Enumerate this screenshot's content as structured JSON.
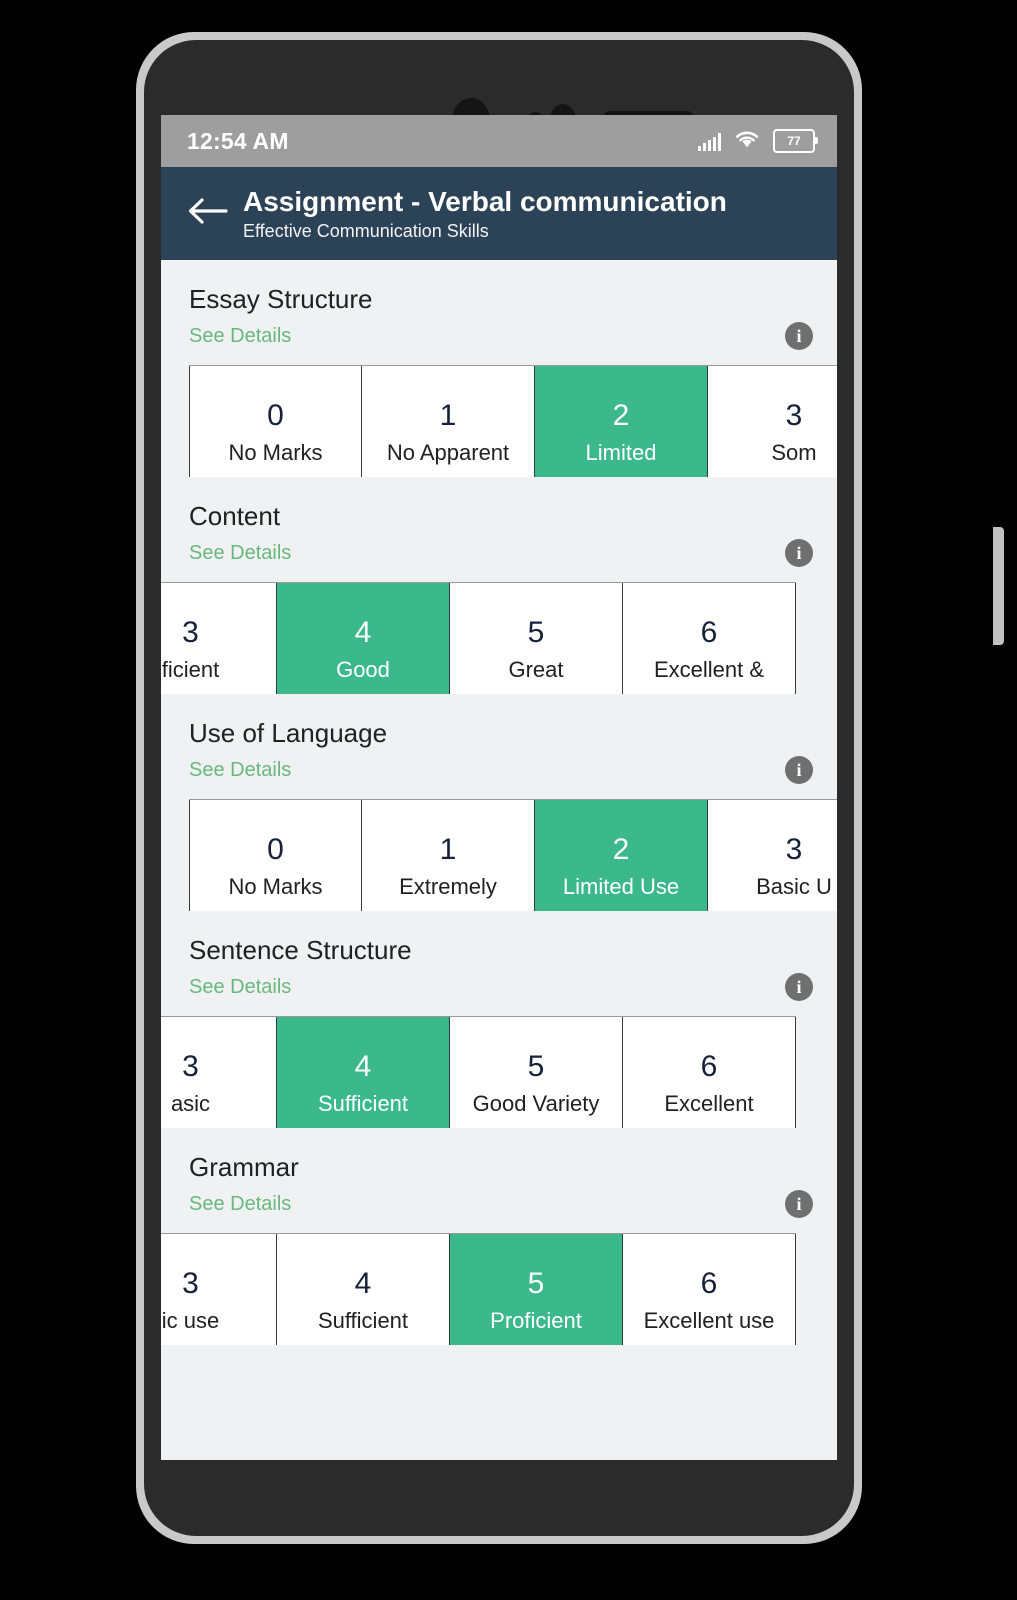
{
  "status_bar": {
    "time": "12:54 AM",
    "signal_icon": "cellular-signal-icon",
    "wifi_icon": "wifi-icon",
    "battery_icon": "battery-icon",
    "battery_level": "77"
  },
  "app_bar": {
    "back_icon": "back-arrow-icon",
    "title": "Assignment - Verbal communication",
    "subtitle": "Effective Communication Skills"
  },
  "common": {
    "see_details_label": "See Details",
    "info_icon": "info-icon",
    "info_glyph": "i",
    "accent_green": "#3bb98a",
    "link_green": "#68b97e",
    "appbar_navy": "#2b4257",
    "page_background": "#eff1f3"
  },
  "criteria": [
    {
      "title": "Essay Structure",
      "scrolled": false,
      "cells": [
        {
          "mark": "0",
          "desc": "No Marks",
          "selected": false
        },
        {
          "mark": "1",
          "desc": "No Apparent",
          "selected": false
        },
        {
          "mark": "2",
          "desc": "Limited",
          "selected": true
        },
        {
          "mark": "3",
          "desc": "Som",
          "selected": false
        }
      ]
    },
    {
      "title": "Content",
      "scrolled": true,
      "cells": [
        {
          "mark": "3",
          "desc": "ficient",
          "selected": false
        },
        {
          "mark": "4",
          "desc": "Good",
          "selected": true
        },
        {
          "mark": "5",
          "desc": "Great",
          "selected": false
        },
        {
          "mark": "6",
          "desc": "Excellent &",
          "selected": false
        }
      ]
    },
    {
      "title": "Use of Language",
      "scrolled": false,
      "cells": [
        {
          "mark": "0",
          "desc": "No Marks",
          "selected": false
        },
        {
          "mark": "1",
          "desc": "Extremely",
          "selected": false
        },
        {
          "mark": "2",
          "desc": "Limited Use",
          "selected": true
        },
        {
          "mark": "3",
          "desc": "Basic U",
          "selected": false
        }
      ]
    },
    {
      "title": "Sentence Structure",
      "scrolled": true,
      "cells": [
        {
          "mark": "3",
          "desc": "asic",
          "selected": false
        },
        {
          "mark": "4",
          "desc": "Sufficient",
          "selected": true
        },
        {
          "mark": "5",
          "desc": "Good Variety",
          "selected": false
        },
        {
          "mark": "6",
          "desc": "Excellent",
          "selected": false
        }
      ]
    },
    {
      "title": "Grammar",
      "scrolled": true,
      "cells": [
        {
          "mark": "3",
          "desc": "ic use",
          "selected": false
        },
        {
          "mark": "4",
          "desc": "Sufficient",
          "selected": false
        },
        {
          "mark": "5",
          "desc": "Proficient",
          "selected": true
        },
        {
          "mark": "6",
          "desc": "Excellent use",
          "selected": false
        }
      ]
    }
  ]
}
